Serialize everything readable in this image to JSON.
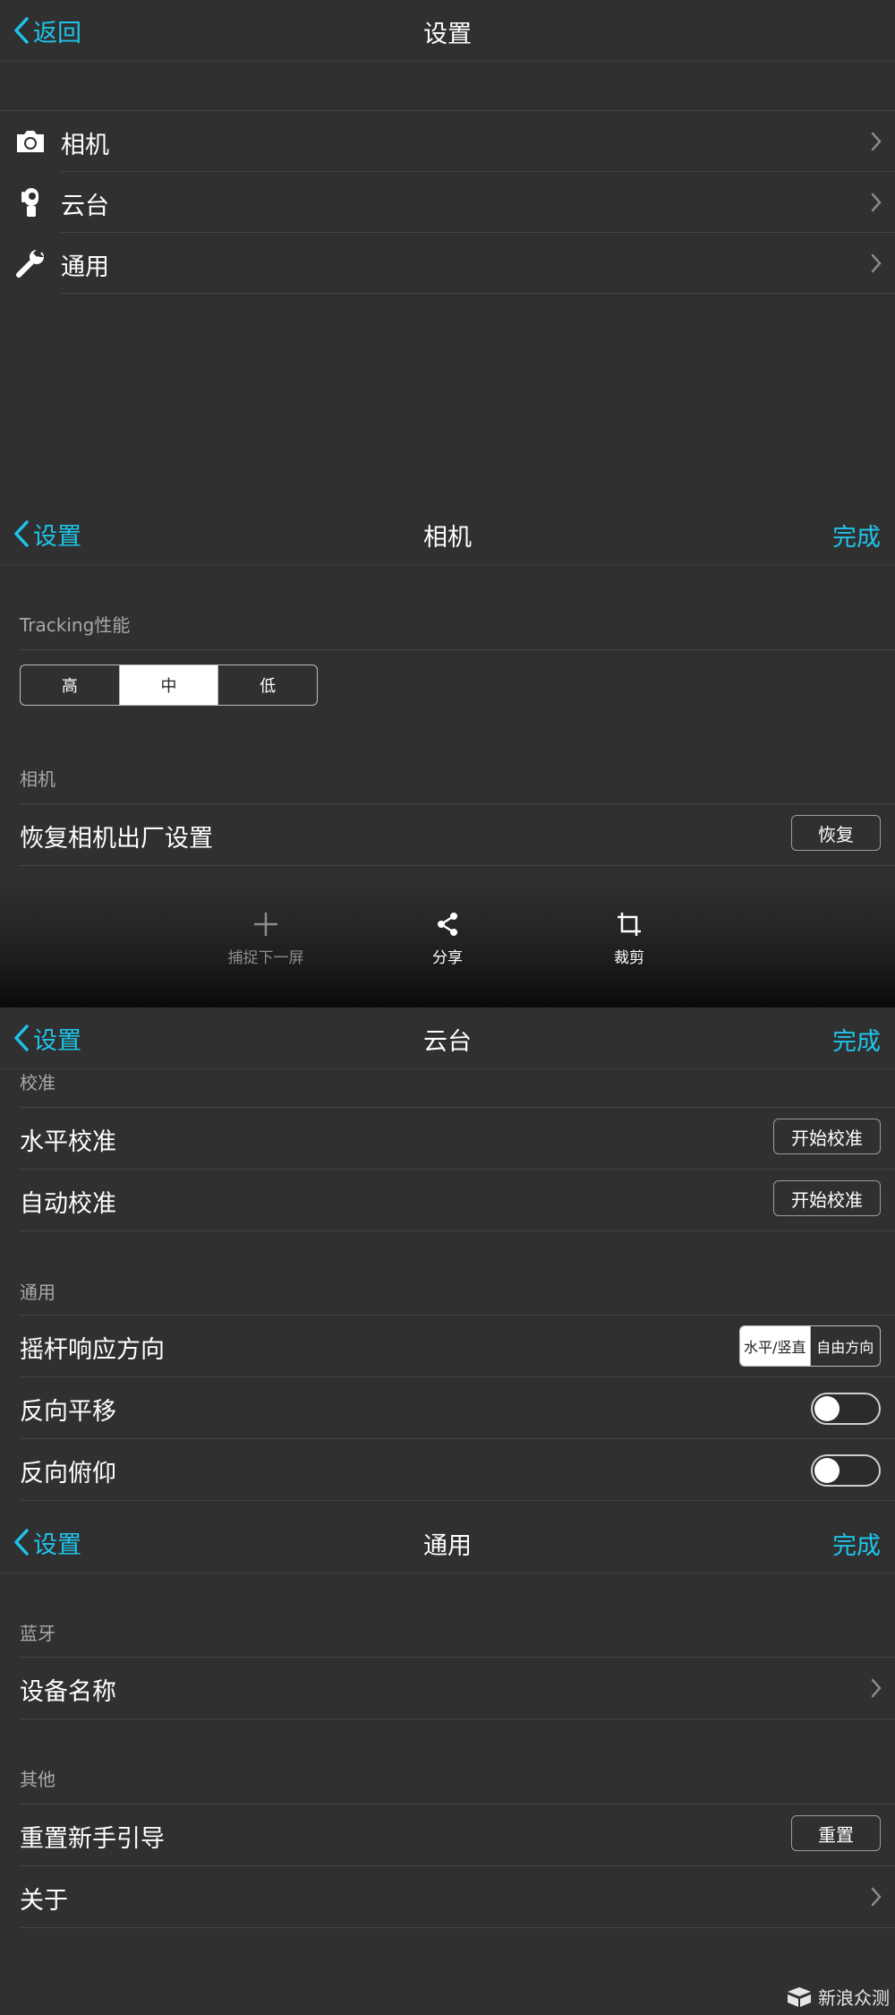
{
  "panel_main": {
    "back": "返回",
    "title": "设置",
    "items": [
      {
        "label": "相机",
        "icon": "camera-icon"
      },
      {
        "label": "云台",
        "icon": "gimbal-icon"
      },
      {
        "label": "通用",
        "icon": "wrench-icon"
      }
    ]
  },
  "panel_camera": {
    "back": "设置",
    "title": "相机",
    "done": "完成",
    "tracking_header": "Tracking性能",
    "tracking_options": [
      "高",
      "中",
      "低"
    ],
    "tracking_selected": "中",
    "camera_header": "相机",
    "reset_label": "恢复相机出厂设置",
    "reset_button": "恢复",
    "toolbar": {
      "capture": "捕捉下一屏",
      "share": "分享",
      "crop": "裁剪"
    }
  },
  "panel_gimbal": {
    "back": "设置",
    "title": "云台",
    "done": "完成",
    "calib_header": "校准",
    "horizontal_label": "水平校准",
    "auto_label": "自动校准",
    "calib_button": "开始校准",
    "general_header": "通用",
    "joystick_label": "摇杆响应方向",
    "joystick_options": [
      "水平/竖直",
      "自由方向"
    ],
    "joystick_selected": "水平/竖直",
    "reverse_pan_label": "反向平移",
    "reverse_pan_on": false,
    "reverse_tilt_label": "反向俯仰",
    "reverse_tilt_on": false
  },
  "panel_general": {
    "back": "设置",
    "title": "通用",
    "done": "完成",
    "bt_header": "蓝牙",
    "device_name_label": "设备名称",
    "other_header": "其他",
    "reset_guide_label": "重置新手引导",
    "reset_button": "重置",
    "about_label": "关于"
  },
  "watermark": "新浪众测",
  "colors": {
    "accent": "#1ec4ea",
    "background": "#303030",
    "divider": "#454545"
  }
}
